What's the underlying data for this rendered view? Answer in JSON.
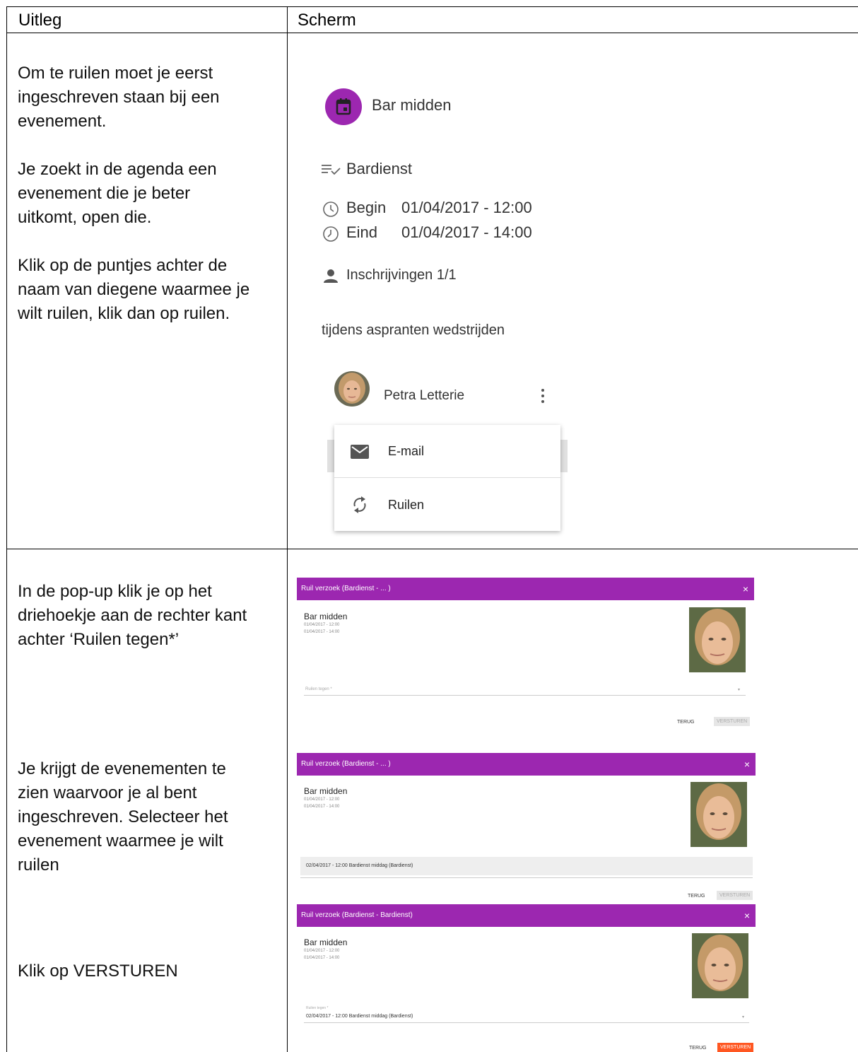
{
  "table": {
    "col1_header": "Uitleg",
    "col2_header": "Scherm"
  },
  "row1": {
    "explanation": [
      "Om te ruilen moet je eerst",
      "ingeschreven staan bij een",
      "evenement.",
      "",
      "Je zoekt in de agenda een",
      "evenement die je beter",
      "uitkomt, open die.",
      "",
      "Klik op de puntjes achter de",
      "naam van diegene waarmee je",
      "wilt ruilen, klik dan op ruilen."
    ],
    "screen": {
      "event_title": "Bar midden",
      "event_icon": "calendar-icon",
      "event_type": "Bardienst",
      "begin_label": "Begin",
      "begin_value": "01/04/2017 - 12:00",
      "end_label": "Eind",
      "end_value": "01/04/2017 - 14:00",
      "registrations": "Inschrijvingen 1/1",
      "description": "tijdens aspranten wedstrijden",
      "person_name": "Petra Letterie",
      "menu": [
        {
          "label": "E-mail",
          "icon": "mail-icon"
        },
        {
          "label": "Ruilen",
          "icon": "swap-icon"
        }
      ]
    }
  },
  "row2": {
    "explanation_a": [
      "In de pop-up klik je op het",
      "driehoekje aan de rechter kant",
      "achter ‘Ruilen tegen*’"
    ],
    "explanation_b": [
      "Je krijgt de evenementen te",
      "zien waarvoor je al bent",
      "ingeschreven. Selecteer het",
      "evenement waarmee je wilt",
      "ruilen"
    ],
    "explanation_c": "Klik op VERSTUREN",
    "dialog1": {
      "header": "Ruil verzoek (Bardienst - ... )",
      "close": "×",
      "title": "Bar midden",
      "line1": "01/04/2017 - 12:00",
      "line2": "01/04/2017 - 14:00",
      "field_label": "Ruilen tegen *",
      "back": "TERUG",
      "send": "VERSTUREN"
    },
    "dialog2": {
      "header": "Ruil verzoek (Bardienst - ... )",
      "close": "×",
      "title": "Bar midden",
      "line1": "01/04/2017 - 12:00",
      "line2": "01/04/2017 - 14:00",
      "option": "02/04/2017 - 12:00 Bardienst middag (Bardienst)",
      "back": "TERUG",
      "send": "VERSTUREN"
    },
    "dialog3": {
      "header": "Ruil verzoek (Bardienst - Bardienst)",
      "close": "×",
      "title": "Bar midden",
      "line1": "01/04/2017 - 12:00",
      "line2": "01/04/2017 - 14:00",
      "field_label": "Ruilen tegen *",
      "field_value": "02/04/2017 - 12:00 Bardienst middag (Bardienst)",
      "back": "TERUG",
      "send": "VERSTUREN"
    }
  },
  "colors": {
    "purple": "#9c27b0",
    "orange": "#ff5722"
  }
}
